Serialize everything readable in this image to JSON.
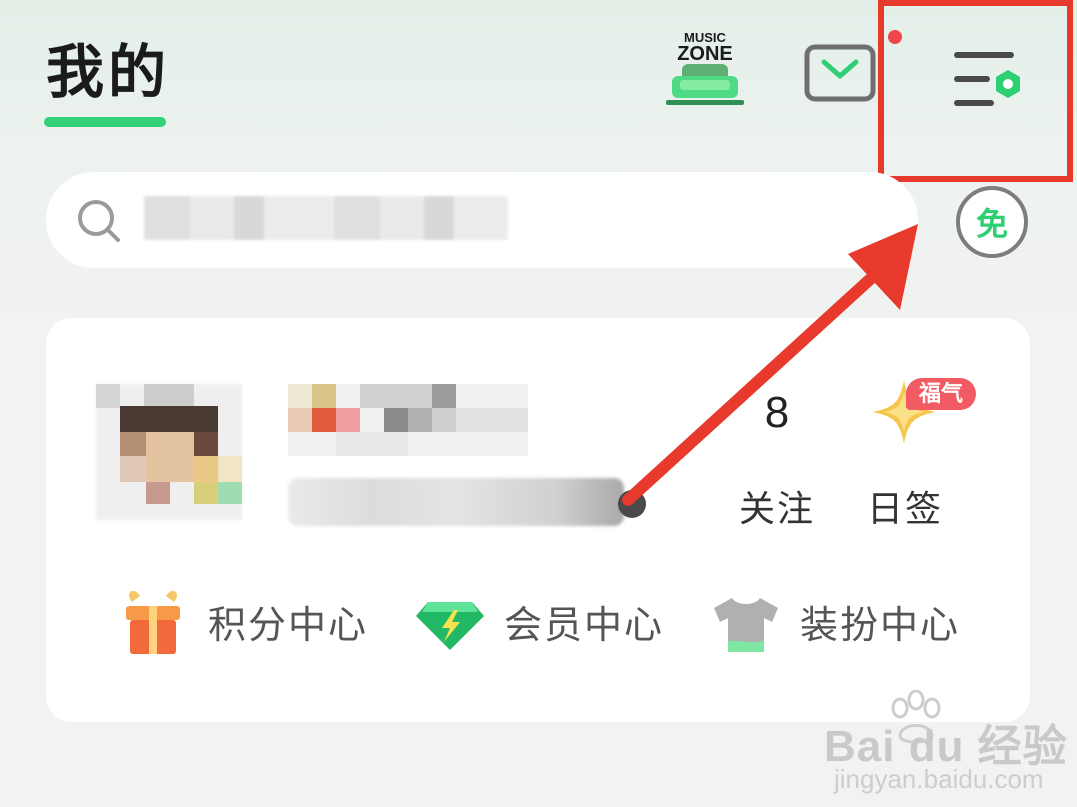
{
  "header": {
    "title": "我的",
    "music_zone_top": "MUSIC",
    "music_zone_bottom": "ZONE"
  },
  "search": {
    "placeholder": ""
  },
  "free_badge": "免",
  "profile": {
    "follow_count": "8",
    "follow_label": "关注",
    "sign_badge": "福气",
    "sign_label": "日签"
  },
  "menu": [
    {
      "label": "积分中心",
      "icon": "gift-icon"
    },
    {
      "label": "会员中心",
      "icon": "diamond-icon"
    },
    {
      "label": "装扮中心",
      "icon": "shirt-icon"
    }
  ],
  "watermark": {
    "brand": "Bai du 经验",
    "url": "jingyan.baidu.com"
  },
  "colors": {
    "accent_green": "#33d27a",
    "annotation_red": "#e8392d",
    "badge_red": "#f25a64"
  }
}
